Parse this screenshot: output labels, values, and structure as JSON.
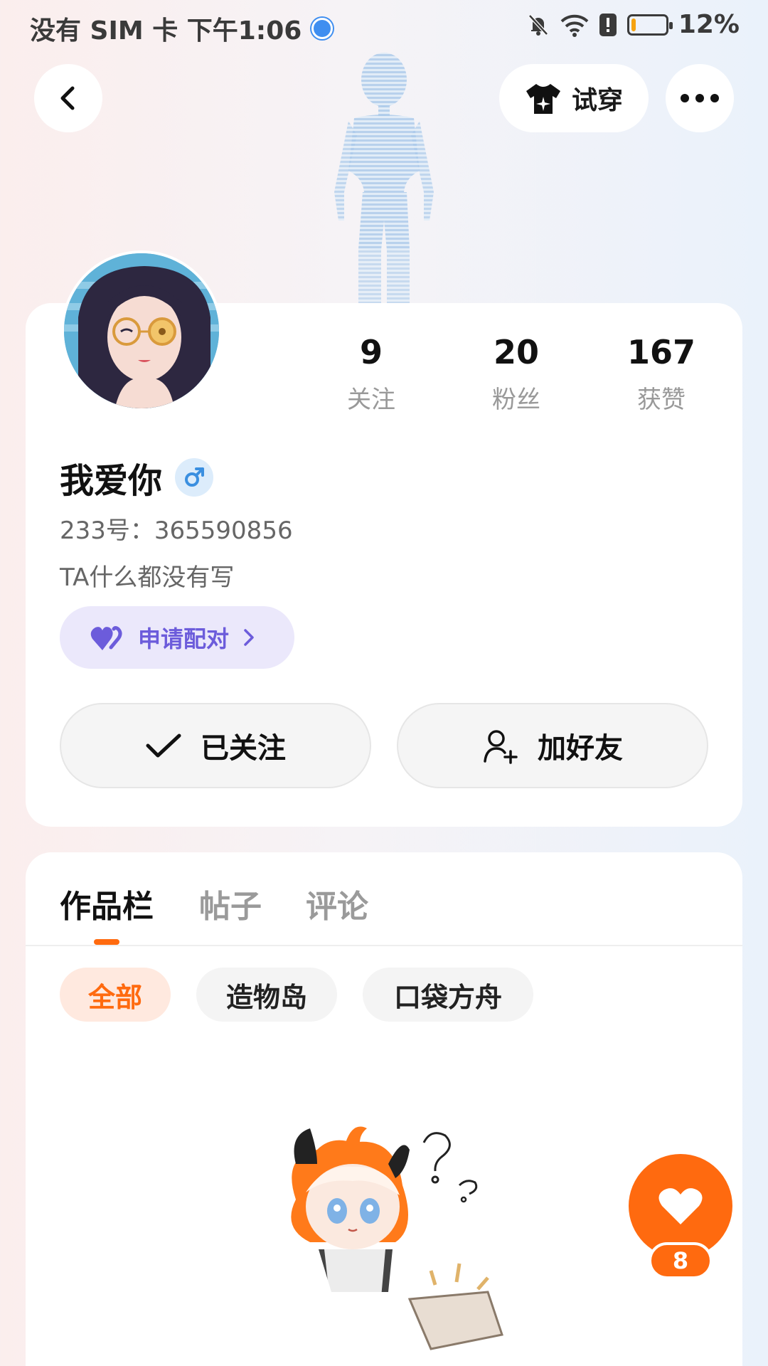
{
  "status_bar": {
    "left_text": "没有 SIM 卡 下午1:06",
    "battery": "12%",
    "battery_level": 0.12,
    "icons": [
      "globe-icon",
      "bell-muted-icon",
      "wifi-icon",
      "alert-icon",
      "battery-icon"
    ]
  },
  "header": {
    "try_on_label": "试穿",
    "icons": [
      "back-arrow-icon",
      "tshirt-sparkle-icon",
      "more-dots-icon"
    ]
  },
  "profile": {
    "stats": [
      {
        "value": "9",
        "label": "关注"
      },
      {
        "value": "20",
        "label": "粉丝"
      },
      {
        "value": "167",
        "label": "获赞"
      }
    ],
    "username": "我爱你",
    "gender_icon": "male-icon",
    "uid": "233号：365590856",
    "bio": "TA什么都没有写",
    "pair_button": "申请配对",
    "follow_button": "已关注",
    "add_friend_button": "加好友"
  },
  "works": {
    "tabs": [
      "作品栏",
      "帖子",
      "评论"
    ],
    "active_tab": "作品栏",
    "filters": [
      "全部",
      "造物岛",
      "口袋方舟"
    ],
    "active_filter": "全部"
  },
  "like_fab": {
    "count": "8"
  },
  "colors": {
    "accent": "#ff6a0f",
    "pair_purple": "#6c5cdb",
    "gender_blue": "#3a8fe0"
  }
}
